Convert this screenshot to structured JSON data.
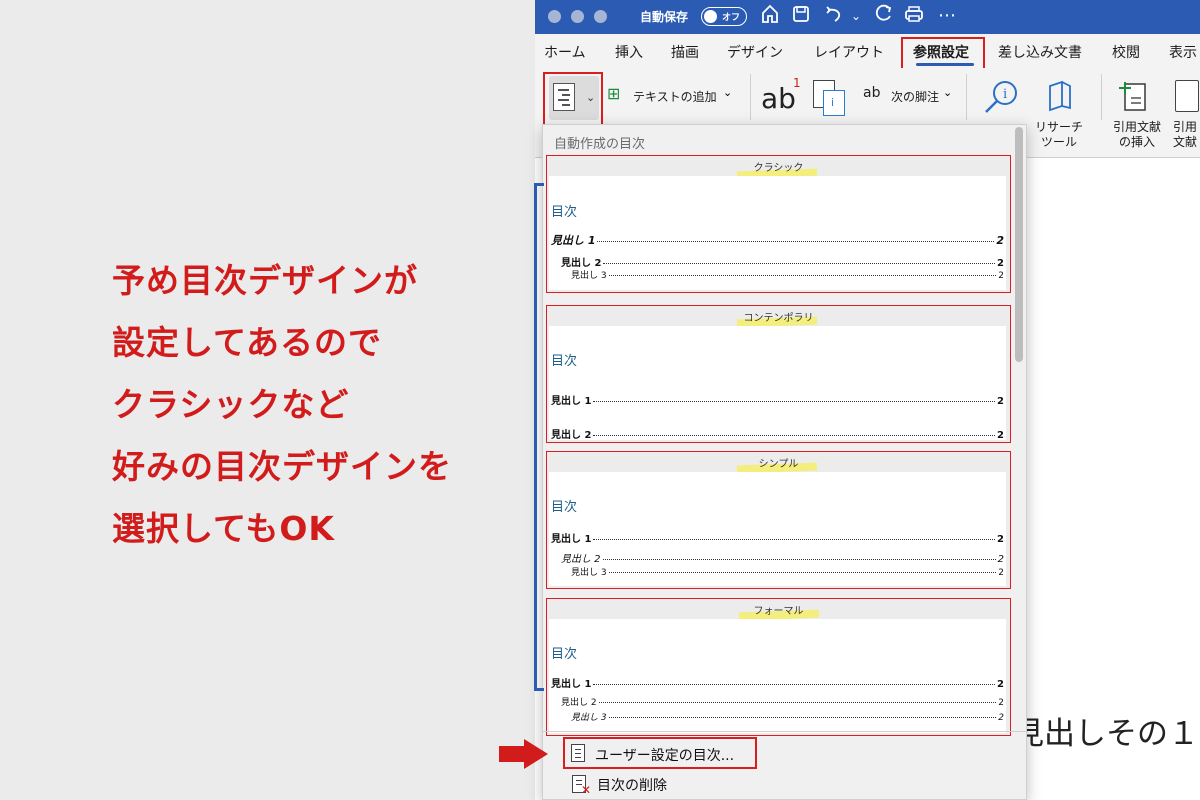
{
  "annotation": {
    "lines": [
      "予め目次デザインが",
      "設定してあるので",
      "クラシックなど",
      "好みの目次デザインを",
      "選択してもOK"
    ],
    "color": "#d21b1b"
  },
  "titlebar": {
    "autosave_label": "自動保存",
    "autosave_state": "オフ",
    "icons": [
      "home-icon",
      "save-icon",
      "undo-icon",
      "redo-icon",
      "print-icon",
      "more-icon"
    ],
    "color": "#2b5bb3"
  },
  "ribbon_tabs": [
    {
      "label": "ホーム"
    },
    {
      "label": "挿入"
    },
    {
      "label": "描画"
    },
    {
      "label": "デザイン"
    },
    {
      "label": "レイアウト"
    },
    {
      "label": "参照設定",
      "active": true
    },
    {
      "label": "差し込み文書"
    },
    {
      "label": "校閲"
    },
    {
      "label": "表示"
    }
  ],
  "ribbon": {
    "add_text": "テキストの追加",
    "footnote_label": "ab",
    "footnote_sup": "1",
    "next_footnote": "次の脚注",
    "research_tool": "リサーチ\nツール",
    "insert_citation": "引用文献\nの挿入",
    "citation_short": "引用\n文献"
  },
  "document": {
    "heading_fragment": "見出しその１"
  },
  "dropdown": {
    "header": "自動作成の目次",
    "styles": [
      {
        "name": "クラシック",
        "toc_title": "目次",
        "entries": [
          {
            "text": "見出し 1",
            "page": "2",
            "style": "bold italic"
          },
          {
            "text": "見出し 2",
            "page": "2",
            "style": "bold"
          },
          {
            "text": "見出し 3",
            "page": "2",
            "style": ""
          }
        ]
      },
      {
        "name": "コンテンポラリ",
        "toc_title": "目次",
        "entries": [
          {
            "text": "見出し 1",
            "page": "2",
            "style": "bold"
          },
          {
            "text": "見出し 2",
            "page": "2",
            "style": "bold"
          }
        ]
      },
      {
        "name": "シンプル",
        "toc_title": "目次",
        "entries": [
          {
            "text": "見出し 1",
            "page": "2",
            "style": "bold"
          },
          {
            "text": "見出し 2",
            "page": "2",
            "style": "italic"
          },
          {
            "text": "見出し 3",
            "page": "2",
            "style": ""
          }
        ]
      },
      {
        "name": "フォーマル",
        "toc_title": "目次",
        "entries": [
          {
            "text": "見出し 1",
            "page": "2",
            "style": "bold"
          },
          {
            "text": "見出し 2",
            "page": "2",
            "style": ""
          },
          {
            "text": "見出し 3",
            "page": "2",
            "style": "italic"
          }
        ]
      }
    ],
    "custom_toc": "ユーザー設定の目次...",
    "delete_toc": "目次の削除"
  },
  "colors": {
    "highlight_red": "#d81e1e",
    "bracket_blue": "#2b5bb3",
    "toc_title_blue": "#1f5e8a"
  }
}
